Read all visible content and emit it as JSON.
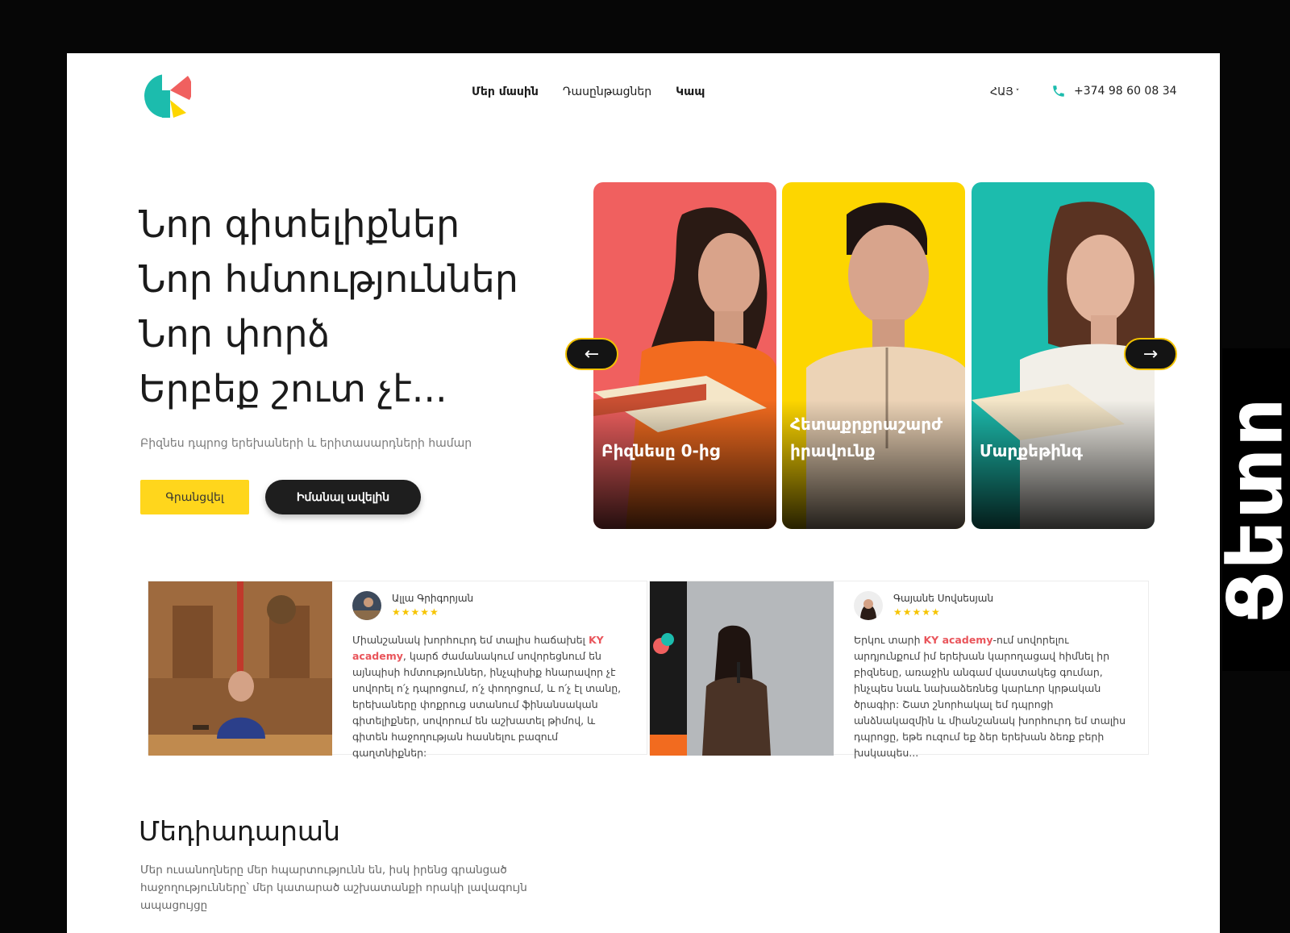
{
  "header": {
    "nav": [
      "Մեր մասին",
      "Դասընթացներ",
      "Կապ"
    ],
    "language": "ՀԱՅ",
    "phone": "+374 98 60 08 34"
  },
  "hero": {
    "lines": [
      "Նոր գիտելիքներ",
      "Նոր հմտություններ",
      "Նոր փորձ",
      "Երբեք շուտ չէ..."
    ],
    "subtitle": "Բիզնես դպրոց երեխաների և երիտասարդների համար",
    "primary_button": "Գրանցվել",
    "secondary_button": "Իմանալ ավելին"
  },
  "carousel": {
    "cards": [
      {
        "label": "Բիզնեսը 0-ից",
        "color": "#f0605f"
      },
      {
        "label": "Հետաքրքրաշարժ իրավունք",
        "color": "#fdd600"
      },
      {
        "label": "Մարքեթինգ",
        "color": "#1cbcad"
      }
    ]
  },
  "reviews": [
    {
      "name": "Ալլա Գրիգորյան",
      "stars": "★★★★★",
      "text_before": "Միանշանակ խորհուրդ եմ տալիս հաճախել ",
      "highlight": "KY academy",
      "text_after": ", կարճ ժամանակում սովորեցնում են այնպիսի հմտություններ, ինչպիսիք հնարավոր չէ սովորել ո՛չ դպրոցում, ո՛չ փողոցում, և ո՛չ էլ տանը, երեխաները փոքրուց ստանում ֆինանսական գիտելիքներ, սովորում են աշխատել թիմով, և գիտեն հաջողության հասնելու բազում գաղտնիքներ:"
    },
    {
      "name": "Գայանե Սովսեսյան",
      "stars": "★★★★★",
      "text_before": "Երկու տարի ",
      "highlight": "KY academy",
      "text_after": "-ում սովորելու արդյունքում իմ երեխան կարողացավ հիմնել իր բիզնեսը, առաջին անգամ վաստակեց գումար, ինչպես նաև նախաձեռնեց կարևոր կրթական ծրագիր: Շատ շնորհակալ եմ դպրոցի անձնակազմին և միանշանակ խորհուրդ եմ տալիս դպրոցը, եթե ուզում եք ձեր երեխան ձեռք բերի խսկապես..."
    }
  ],
  "media": {
    "title": "Մեդիադարան",
    "text": "Մեր ուսանողները մեր հպարտությունն են, իսկ իրենց գրանցած հաջողությունները՝ մեր կատարած աշխատանքի որակի լավագույն ապացույցը"
  },
  "side_tab": "Ցետո",
  "colors": {
    "yellow": "#ffd61c",
    "dark": "#1e1e1e",
    "accent_red": "#e9555b",
    "teal": "#1cbcad"
  }
}
